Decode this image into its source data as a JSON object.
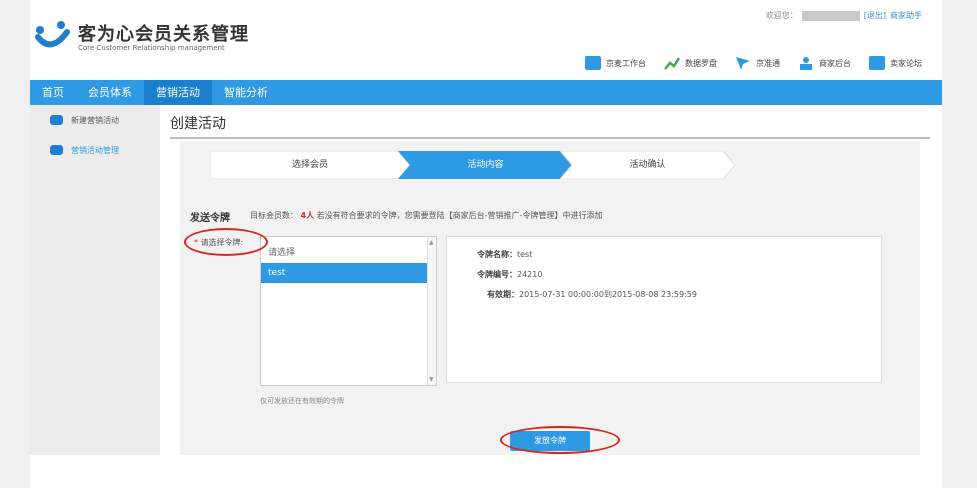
{
  "brand": {
    "title": "客为心会员关系管理",
    "subtitle": "Core Customer Relationship management"
  },
  "welcome": {
    "prefix": "欢迎您：",
    "logout": "[退出]",
    "helper": "商家助手"
  },
  "toplinks": [
    {
      "label": "京麦工作台",
      "icon": "desk-icon",
      "color": "#2f9ae4"
    },
    {
      "label": "数据罗盘",
      "icon": "chart-icon",
      "color": "#3aa84b"
    },
    {
      "label": "京准通",
      "icon": "arrow-icon",
      "color": "#2f9ae4"
    },
    {
      "label": "商家后台",
      "icon": "shop-icon",
      "color": "#2f9ae4"
    },
    {
      "label": "卖家论坛",
      "icon": "forum-icon",
      "color": "#2f9ae4"
    }
  ],
  "nav": [
    {
      "label": "首页"
    },
    {
      "label": "会员体系"
    },
    {
      "label": "营销活动"
    },
    {
      "label": "智能分析"
    }
  ],
  "sidebar": [
    {
      "label": "新建营销活动"
    },
    {
      "label": "营销活动管理"
    }
  ],
  "page_title": "创建活动",
  "steps": [
    {
      "label": "选择会员"
    },
    {
      "label": "活动内容"
    },
    {
      "label": "活动确认"
    }
  ],
  "send": {
    "label": "发送令牌",
    "info_prefix": "目标会员数：",
    "count": "4人",
    "info_suffix": "若没有符合要求的令牌，您需要登陆【商家后台-营销推广-令牌管理】中进行添加"
  },
  "select_label": "请选择令牌:",
  "select_star": "*",
  "list": {
    "placeholder": "请选择",
    "options": [
      "test"
    ]
  },
  "detail": {
    "name_label": "令牌名称：",
    "name": "test",
    "code_label": "令牌编号：",
    "code": "24210",
    "valid_label": "有效期：",
    "valid": "2015-07-31 00:00:00到2015-08-08 23:59:59"
  },
  "note": "仅可发放还在有效期的令牌",
  "send_button": "发放令牌",
  "colors": {
    "nav": "#2f9ae4",
    "accent": "#2f9ae4",
    "warning": "#d9261c"
  }
}
